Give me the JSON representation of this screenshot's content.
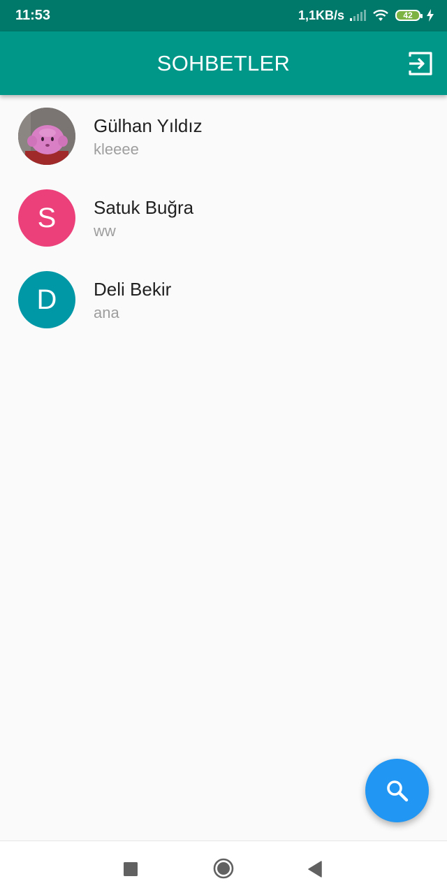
{
  "status_bar": {
    "time": "11:53",
    "net_speed": "1,1KB/s",
    "battery_level": "42",
    "icons": [
      "signal-icon",
      "wifi-icon",
      "battery-icon",
      "charging-icon"
    ]
  },
  "app_bar": {
    "title": "SOHBETLER",
    "logout_icon": "logout-icon"
  },
  "chats": [
    {
      "name": "Gülhan Yıldız",
      "last_message": "kleeee",
      "avatar_type": "photo",
      "avatar_letter": ""
    },
    {
      "name": "Satuk Buğra",
      "last_message": "ww",
      "avatar_type": "letter",
      "avatar_letter": "S",
      "avatar_color": "#ec407a"
    },
    {
      "name": "Deli Bekir",
      "last_message": "ana",
      "avatar_type": "letter",
      "avatar_letter": "D",
      "avatar_color": "#0097a7"
    }
  ],
  "fab": {
    "icon": "search-icon",
    "color": "#2196f3"
  },
  "colors": {
    "primary": "#009688",
    "primary_dark": "#00796b"
  },
  "nav_bar": {
    "icons": [
      "recents-icon",
      "home-icon",
      "back-icon"
    ]
  }
}
